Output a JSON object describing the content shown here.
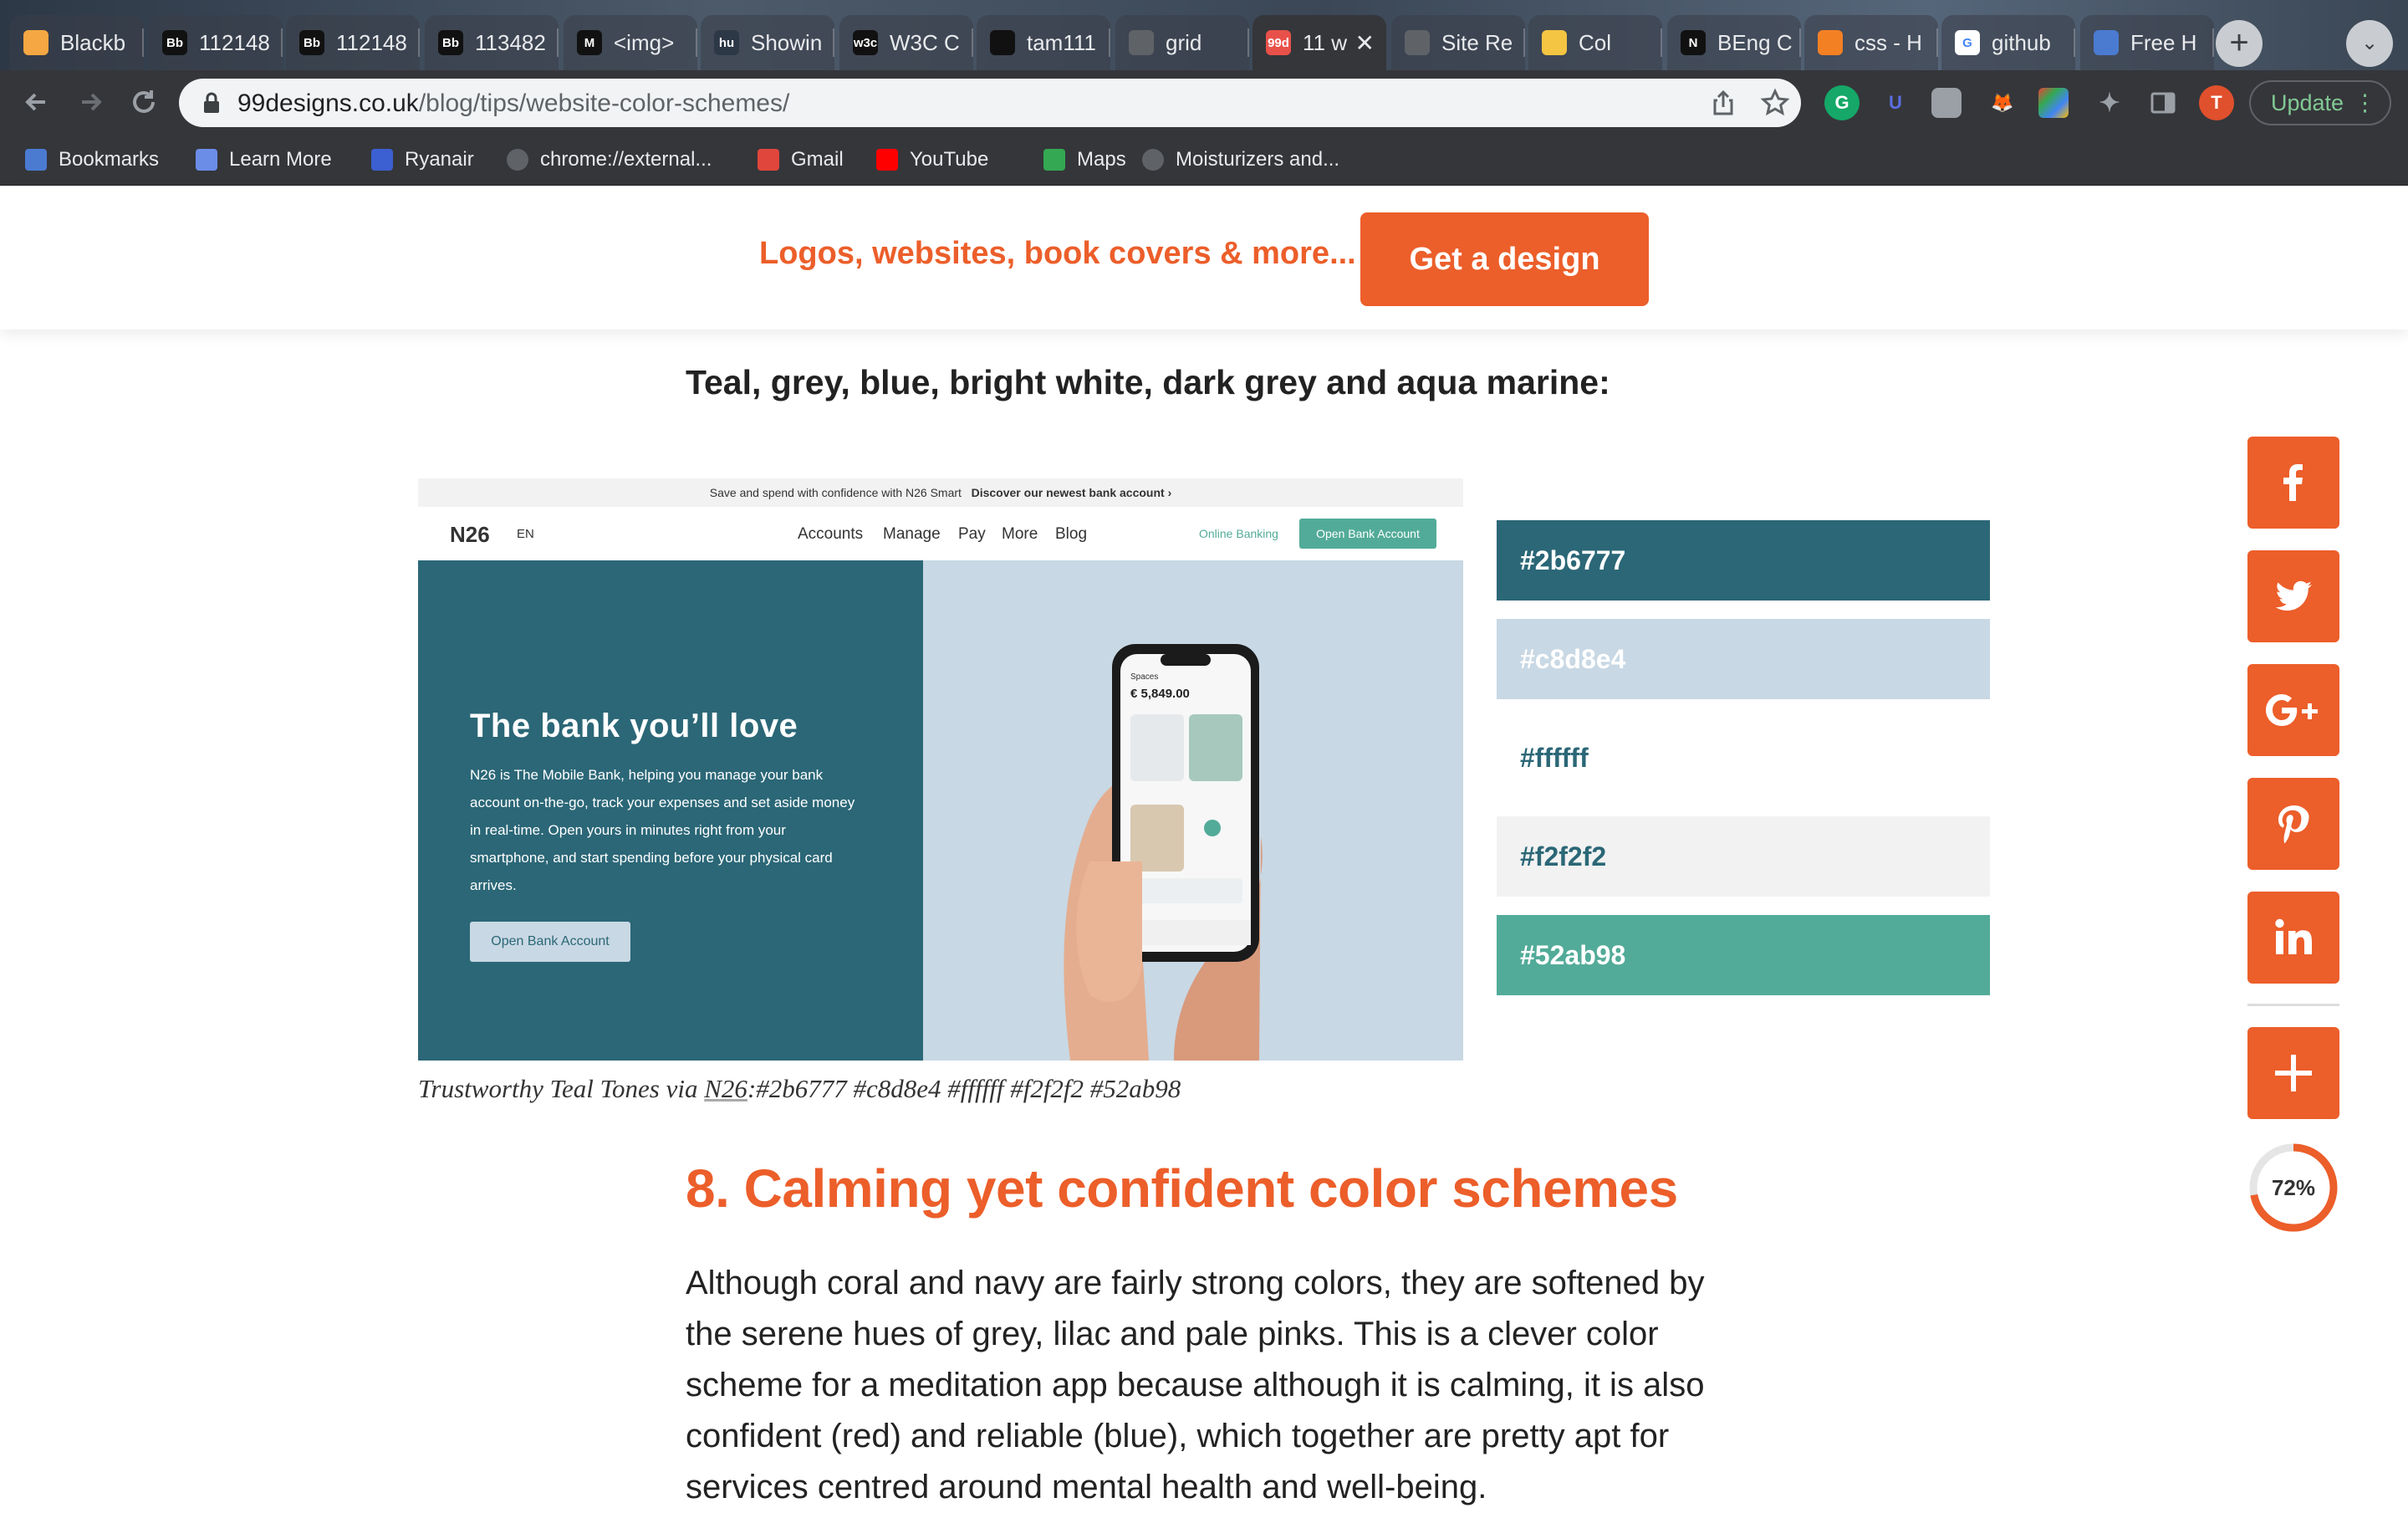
{
  "browser": {
    "tabs": [
      {
        "label": "Blackb",
        "favicon": "pencil-icon",
        "color": "#f4a742"
      },
      {
        "label": "112148",
        "favicon": "Bb",
        "color": "#111111"
      },
      {
        "label": "112148",
        "favicon": "Bb",
        "color": "#111111"
      },
      {
        "label": "113482",
        "favicon": "Bb",
        "color": "#111111"
      },
      {
        "label": "<img>",
        "favicon": "M",
        "color": "#111111"
      },
      {
        "label": "Showin",
        "favicon": "hu",
        "color": "#2d3846"
      },
      {
        "label": "W3C C",
        "favicon": "w3c",
        "color": "#111111"
      },
      {
        "label": "tam111",
        "favicon": "github-icon",
        "color": "#111111"
      },
      {
        "label": "grid",
        "favicon": "globe-icon",
        "color": "#5f6368"
      },
      {
        "label": "11 w",
        "favicon": "99d",
        "color": "#e8514a",
        "active": true
      },
      {
        "label": "Site Re",
        "favicon": "globe-icon",
        "color": "#5f6368"
      },
      {
        "label": "Col",
        "favicon": "thumb-icon",
        "color": "#f4c542"
      },
      {
        "label": "BEng C",
        "favicon": "N",
        "color": "#111111"
      },
      {
        "label": "css - H",
        "favicon": "stack-icon",
        "color": "#f48024"
      },
      {
        "label": "github",
        "favicon": "G",
        "color": "#ffffff"
      },
      {
        "label": "Free H",
        "favicon": "person-icon",
        "color": "#4a7bd1"
      }
    ],
    "close_glyph": "✕",
    "new_tab_glyph": "+",
    "tab_search_glyph": "⌄",
    "url_domain": "99designs.co.uk",
    "url_path": "/blog/tips/website-color-schemes/",
    "profile_initial": "T",
    "update_label": "Update",
    "bookmarks": [
      {
        "label": "Bookmarks",
        "icon": "star-icon",
        "color": "#4a7bd1"
      },
      {
        "label": "Learn More",
        "icon": "cube-icon",
        "color": "#6b8de8"
      },
      {
        "label": "Ryanair",
        "icon": "ryanair-icon",
        "color": "#3c5fd1"
      },
      {
        "label": "chrome://external...",
        "icon": "globe-icon",
        "color": "#5f6368"
      },
      {
        "label": "Gmail",
        "icon": "gmail-icon",
        "color": "#e0463b"
      },
      {
        "label": "YouTube",
        "icon": "youtube-icon",
        "color": "#ff0000"
      },
      {
        "label": "Maps",
        "icon": "maps-icon",
        "color": "#34a853"
      },
      {
        "label": "Moisturizers and...",
        "icon": "globe-icon",
        "color": "#5f6368"
      }
    ]
  },
  "page": {
    "tagline": "Logos, websites, book covers & more...",
    "cta_label": "Get a design",
    "subheading": "Teal, grey, blue, bright white, dark grey and aqua marine:",
    "n26": {
      "promo": "Save and spend with confidence with N26 Smart",
      "promo_link": "Discover our newest bank account  ›",
      "logo": "N26",
      "lang": "EN",
      "nav": [
        "Accounts",
        "Manage",
        "Pay",
        "More",
        "Blog"
      ],
      "online_banking": "Online Banking",
      "open_account": "Open Bank Account",
      "hero_title": "The bank you’ll love",
      "hero_text": "N26 is The Mobile Bank, helping you manage your bank account on-the-go, track your expenses and set aside money in real-time. Open yours in minutes right from your smartphone, and start spending before your physical card arrives.",
      "hero_cta": "Open Bank Account",
      "phone_label": "Spaces",
      "phone_amount": "€ 5,849.00"
    },
    "swatches": [
      {
        "label": "#2b6777",
        "bg": "#2b6777",
        "fg": "#ffffff"
      },
      {
        "label": "#c8d8e4",
        "bg": "#c8d8e4",
        "fg": "#ffffff"
      },
      {
        "label": "#ffffff",
        "bg": "#ffffff",
        "fg": "#2b6777"
      },
      {
        "label": "#f2f2f2",
        "bg": "#f2f2f2",
        "fg": "#2b6777"
      },
      {
        "label": "#52ab98",
        "bg": "#52ab98",
        "fg": "#ffffff"
      }
    ],
    "caption_prefix": "Trustworthy Teal Tones via ",
    "caption_link": "N26",
    "caption_suffix": ":#2b6777 #c8d8e4 #ffffff #f2f2f2 #52ab98",
    "section_title": "8. Calming yet confident color schemes",
    "body": "Although coral and navy are fairly strong colors, they are softened by the serene hues of grey, lilac and pale pinks. This is a clever color scheme for a meditation app because although it is calming, it is also confident (red) and reliable (blue), which together are pretty apt for services centred around mental health and well-being.",
    "share": [
      {
        "name": "facebook-icon",
        "glyph": "f"
      },
      {
        "name": "twitter-icon",
        "glyph": "twitter"
      },
      {
        "name": "google-plus-icon",
        "glyph": "G+"
      },
      {
        "name": "pinterest-icon",
        "glyph": "P"
      },
      {
        "name": "linkedin-icon",
        "glyph": "in"
      }
    ],
    "more_glyph": "+",
    "progress_label": "72%",
    "progress_value": 0.72,
    "accent": "#ec5e2a"
  }
}
